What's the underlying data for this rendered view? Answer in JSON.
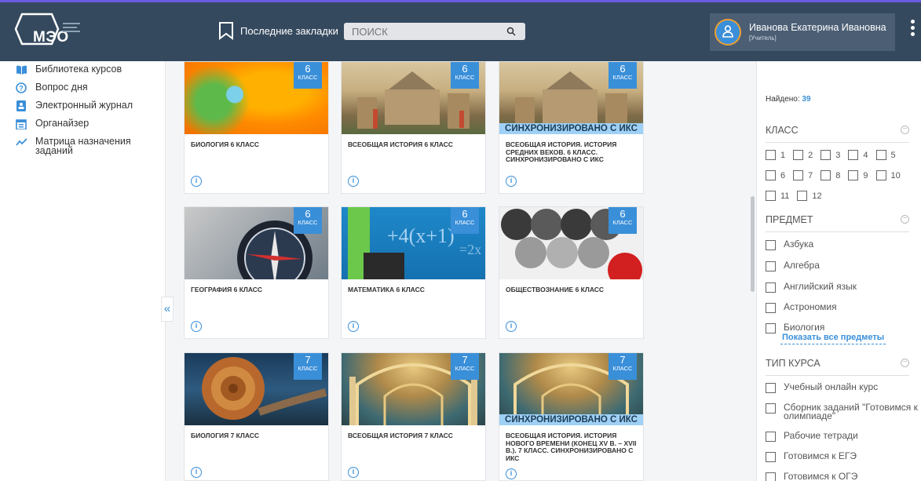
{
  "header": {
    "logo_text": "МЭО",
    "bookmarks_label": "Последние закладки",
    "search_placeholder": "ПОИСК",
    "user_name": "Иванова Екатерина Ивановна",
    "user_role": "[Учитель]"
  },
  "sidebar": {
    "items": [
      {
        "label": "Библиотека курсов",
        "icon": "book-icon"
      },
      {
        "label": "Вопрос дня",
        "icon": "question-icon"
      },
      {
        "label": "Электронный журнал",
        "icon": "journal-icon"
      },
      {
        "label": "Органайзер",
        "icon": "calendar-icon"
      },
      {
        "label": "Матрица назначения заданий",
        "icon": "chart-icon"
      }
    ],
    "collapse_label": "«"
  },
  "ribbon_label": "КЛАСС",
  "sync_label": "СИНХРОНИЗИРОВАНО С ИКС",
  "courses": [
    {
      "grade": "6",
      "title": "БИОЛОГИЯ 6 КЛАСС",
      "sync": false
    },
    {
      "grade": "6",
      "title": "ВСЕОБЩАЯ ИСТОРИЯ 6 КЛАСС",
      "sync": false
    },
    {
      "grade": "6",
      "title": "ВСЕОБЩАЯ ИСТОРИЯ. ИСТОРИЯ СРЕДНИХ ВЕКОВ. 6 КЛАСС. СИНХРОНИЗИРОВАНО С ИКС",
      "sync": true
    },
    {
      "grade": "6",
      "title": "ГЕОГРАФИЯ 6 КЛАСС",
      "sync": false
    },
    {
      "grade": "6",
      "title": "МАТЕМАТИКА 6 КЛАСС",
      "sync": false
    },
    {
      "grade": "6",
      "title": "ОБЩЕСТВОЗНАНИЕ 6 КЛАСС",
      "sync": false
    },
    {
      "grade": "7",
      "title": "БИОЛОГИЯ 7 КЛАСС",
      "sync": false
    },
    {
      "grade": "7",
      "title": "ВСЕОБЩАЯ ИСТОРИЯ 7 КЛАСС",
      "sync": false
    },
    {
      "grade": "7",
      "title": "ВСЕОБЩАЯ ИСТОРИЯ. ИСТОРИЯ НОВОГО ВРЕМЕНИ (КОНЕЦ XV В. – XVII В.). 7 КЛАСС. СИНХРОНИЗИРОВАНО С ИКС",
      "sync": true
    }
  ],
  "filters": {
    "close": "×",
    "found_label": "Найдено:",
    "found_count": "39",
    "grade_section": "КЛАСС",
    "grades": [
      "1",
      "2",
      "3",
      "4",
      "5",
      "6",
      "7",
      "8",
      "9",
      "10",
      "11",
      "12"
    ],
    "subject_section": "ПРЕДМЕТ",
    "subjects": [
      "Азбука",
      "Алгебра",
      "Английский язык",
      "Астрономия",
      "Биология"
    ],
    "show_all": "Показать все предметы",
    "type_section": "ТИП КУРСА",
    "types": [
      "Учебный онлайн курс",
      "Сборник заданий \"Готовимся к олимпиаде\"",
      "Рабочие тетради",
      "Готовимся к ЕГЭ",
      "Готовимся к ОГЭ"
    ]
  }
}
